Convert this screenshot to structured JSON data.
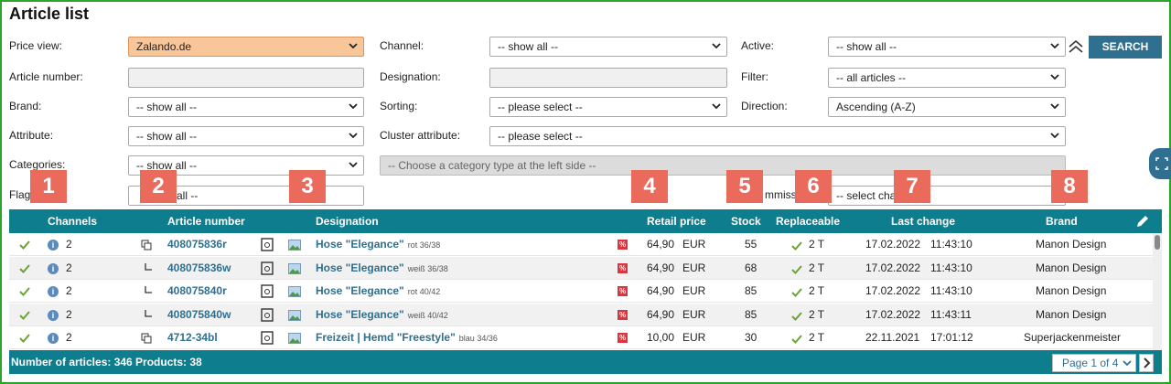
{
  "title": "Article list",
  "filters": {
    "price_view_label": "Price view:",
    "price_view_value": "Zalando.de",
    "article_number_label": "Article number:",
    "brand_label": "Brand:",
    "brand_value": "-- show all --",
    "attribute_label": "Attribute:",
    "attribute_value": "-- show all --",
    "categories_label": "Categories:",
    "categories_value": "-- show all --",
    "flag_label": "Flag",
    "flag_value": "all --",
    "channel_label": "Channel:",
    "channel_value": "-- show all --",
    "designation_label": "Designation:",
    "sorting_label": "Sorting:",
    "sorting_value": "-- please select --",
    "cluster_label": "Cluster attribute:",
    "cluster_value": "-- please select --",
    "category_type_value": "-- Choose a category type at the left side --",
    "active_label": "Active:",
    "active_value": "-- show all --",
    "filter_label": "Filter:",
    "filter_value": "-- all articles --",
    "direction_label": "Direction:",
    "direction_value": "Ascending (A-Z)",
    "commission_label": "mmissi",
    "commission_value": "-- select cha",
    "search_button": "SEARCH"
  },
  "badges": [
    "1",
    "2",
    "3",
    "4",
    "5",
    "6",
    "7",
    "8"
  ],
  "columns": {
    "channels": "Channels",
    "article_number": "Article number",
    "designation": "Designation",
    "retail_price": "Retail price",
    "stock": "Stock",
    "replaceable": "Replaceable",
    "last_change": "Last change",
    "brand": "Brand"
  },
  "rows": [
    {
      "channels": "2",
      "artno": "408075836r",
      "name": "Hose \"Elegance\"",
      "variant": "rot 36/38",
      "price": "64,90",
      "currency": "EUR",
      "stock": "55",
      "repl": "2 T",
      "date": "17.02.2022",
      "time": "11:43:10",
      "brand": "Manon Design"
    },
    {
      "channels": "2",
      "artno": "408075836w",
      "name": "Hose \"Elegance\"",
      "variant": "weiß 36/38",
      "price": "64,90",
      "currency": "EUR",
      "stock": "68",
      "repl": "2 T",
      "date": "17.02.2022",
      "time": "11:43:10",
      "brand": "Manon Design"
    },
    {
      "channels": "2",
      "artno": "408075840r",
      "name": "Hose \"Elegance\"",
      "variant": "rot 40/42",
      "price": "64,90",
      "currency": "EUR",
      "stock": "85",
      "repl": "2 T",
      "date": "17.02.2022",
      "time": "11:43:10",
      "brand": "Manon Design"
    },
    {
      "channels": "2",
      "artno": "408075840w",
      "name": "Hose \"Elegance\"",
      "variant": "weiß 40/42",
      "price": "64,90",
      "currency": "EUR",
      "stock": "85",
      "repl": "2 T",
      "date": "17.02.2022",
      "time": "11:43:11",
      "brand": "Manon Design"
    },
    {
      "channels": "2",
      "artno": "4712-34bl",
      "name": "Freizeit | Hemd \"Freestyle\"",
      "variant": "blau 34/36",
      "price": "10,00",
      "currency": "EUR",
      "stock": "30",
      "repl": "2 T",
      "date": "22.11.2021",
      "time": "17:01:12",
      "brand": "Superjackenmeister"
    }
  ],
  "footer": {
    "count_text": "Number of articles: 346  Products: 38",
    "page_text": "Page 1 of 4"
  },
  "colors": {
    "teal_header": "#0e7d8d",
    "badge": "#ea6a5c",
    "search_button": "#2f6f8f",
    "price_view_bg": "#f9c69a"
  }
}
